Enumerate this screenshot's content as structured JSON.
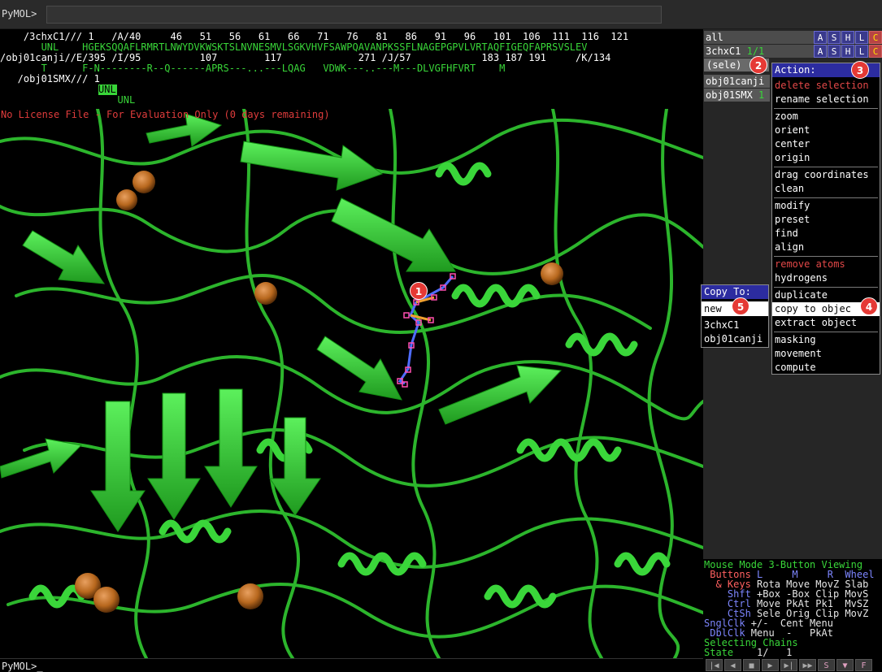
{
  "topbar": {
    "prompt": "PyMOL>",
    "command": ""
  },
  "sequence": {
    "rows": [
      {
        "label": "    /3chxC1///",
        "text": " 1   /A/40     46   51   56   61   66   71   76   81   86   91   96   101  106  111  116  121"
      },
      {
        "label": "",
        "text": "       UNL    HGEKSQQAFLRMRTLNWYDVKWSKTSLNVNESMVLSGKVHVFSAWPQAVANPKSSFLNAGEPGPVLVRTAQFIGEQFAPRSVSLEV"
      },
      {
        "label": "/obj01canji//E/395",
        "text": " /I/95          107        117             271 /J/57            183 187 191     /K/134"
      },
      {
        "label": "",
        "text": "       T      F-N--------R--Q------APRS---...---LQAG   VDWK---..---M---DLVGFHFVRT    M"
      },
      {
        "label": "   /obj01SMX///",
        "text": " 1"
      },
      {
        "label": "",
        "text": "       UNL"
      }
    ]
  },
  "viewport": {
    "license_text": "No License File - For Evaluation Only (0 days remaining)"
  },
  "objects_panel": {
    "all": {
      "name": "all"
    },
    "chx": {
      "name": "3chxC1",
      "state": "1/1"
    },
    "sele": {
      "name": "(sele)"
    },
    "canji": {
      "name": "obj01canji"
    },
    "smx": {
      "name": "obj01SMX",
      "state": "1"
    },
    "buttons": [
      "A",
      "S",
      "H",
      "L",
      "C"
    ]
  },
  "action_menu": {
    "header": "Action:",
    "items": {
      "delete": "delete selection",
      "rename": "rename selection",
      "zoom": "zoom",
      "orient": "orient",
      "center": "center",
      "origin": "origin",
      "drag": "drag coordinates",
      "clean": "clean",
      "modify": "modify",
      "preset": "preset",
      "find": "find",
      "align": "align",
      "remove": "remove atoms",
      "hydrogens": "hydrogens",
      "duplicate": "duplicate",
      "copy": "copy to objec",
      "extract": "extract object",
      "masking": "masking",
      "movement": "movement",
      "compute": "compute"
    }
  },
  "copy_menu": {
    "header": "Copy To:",
    "new": "new",
    "opt1": "3chxC1",
    "opt2": "obj01canji"
  },
  "badges": [
    "1",
    "2",
    "3",
    "4",
    "5"
  ],
  "mouse_panel": {
    "l1a": "Mouse Mode ",
    "l1b": "3-Button Viewing",
    "l2a": " Buttons ",
    "l2b": "L     M     R  Wheel",
    "l3a": "  & Keys ",
    "l3b": "Rota Move MovZ Slab",
    "l4a": "    Shft ",
    "l4b": "+Box -Box Clip MovS",
    "l5a": "    Ctrl ",
    "l5b": "Move PkAt Pk1  MvSZ",
    "l6a": "    CtSh ",
    "l6b": "Sele Orig Clip MovZ",
    "l7a": "SnglClk ",
    "l7b": "+/-  Cent Menu",
    "l8a": " DblClk ",
    "l8b": "Menu  -   PkAt",
    "l9": "Selecting Chains",
    "l10a": "State ",
    "l10b": "   1/   1"
  },
  "bottom": {
    "prompt": "PyMOL>_"
  },
  "player": [
    "|◀",
    "◀",
    "■",
    "▶",
    "▶|",
    "▶▶",
    "S",
    "▼",
    "F"
  ],
  "colors": {
    "green": "#39d639",
    "red": "#e53935",
    "menu_header": "#2c2ca0"
  }
}
